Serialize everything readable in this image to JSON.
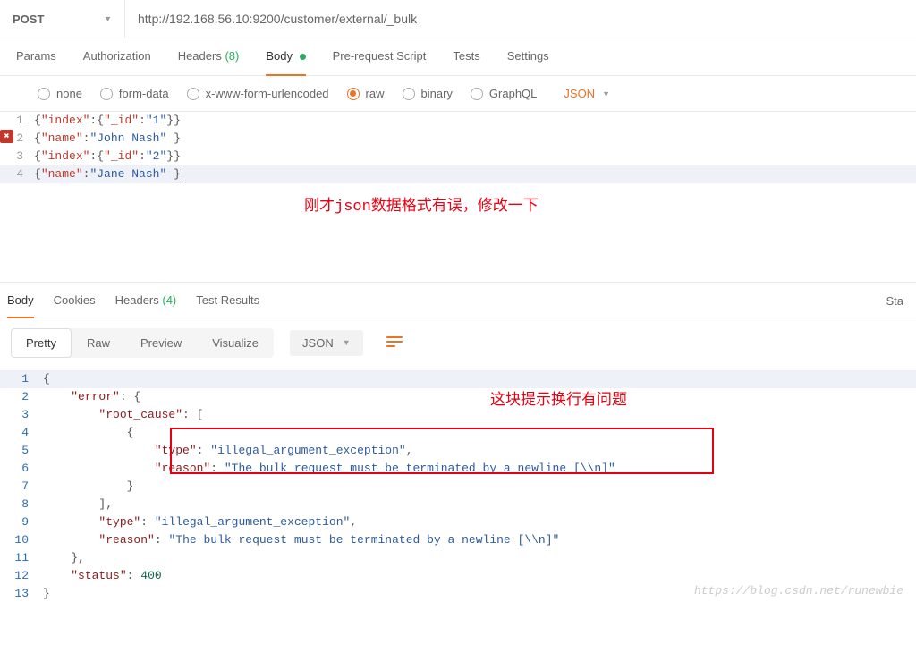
{
  "request": {
    "method": "POST",
    "url": "http://192.168.56.10:9200/customer/external/_bulk"
  },
  "tabs": {
    "params": "Params",
    "authorization": "Authorization",
    "headers": "Headers",
    "headers_count": "(8)",
    "body": "Body",
    "prerequest": "Pre-request Script",
    "tests": "Tests",
    "settings": "Settings"
  },
  "body_types": {
    "none": "none",
    "formdata": "form-data",
    "urlencoded": "x-www-form-urlencoded",
    "raw": "raw",
    "binary": "binary",
    "graphql": "GraphQL",
    "format": "JSON"
  },
  "request_body_lines": [
    "1",
    "2",
    "3",
    "4"
  ],
  "request_body": {
    "l1_index": "\"index\"",
    "l1_id_key": "\"_id\"",
    "l1_id_val": "\"1\"",
    "l2_name_key": "\"name\"",
    "l2_name_val": "\"John Nash\"",
    "l3_index": "\"index\"",
    "l3_id_key": "\"_id\"",
    "l3_id_val": "\"2\"",
    "l4_name_key": "\"name\"",
    "l4_name_val": "\"Jane Nash\"",
    "brace_open": "{",
    "brace_close": "}",
    "colon": ":",
    "space": " "
  },
  "annotations": {
    "note1": "刚才json数据格式有误，修改一下",
    "note2": "这块提示换行有问题"
  },
  "response_tabs": {
    "body": "Body",
    "cookies": "Cookies",
    "headers": "Headers",
    "headers_count": "(4)",
    "tests": "Test Results",
    "status_label": "Sta"
  },
  "view_modes": {
    "pretty": "Pretty",
    "raw": "Raw",
    "preview": "Preview",
    "visualize": "Visualize",
    "format": "JSON"
  },
  "response_lines": [
    "1",
    "2",
    "3",
    "4",
    "5",
    "6",
    "7",
    "8",
    "9",
    "10",
    "11",
    "12",
    "13"
  ],
  "response_json": {
    "error_key": "\"error\"",
    "root_cause_key": "\"root_cause\"",
    "type_key": "\"type\"",
    "type_val": "\"illegal_argument_exception\"",
    "reason_key": "\"reason\"",
    "reason_val": "\"The bulk request must be terminated by a newline [\\\\n]\"",
    "status_key": "\"status\"",
    "status_val": "400",
    "brace_open": "{",
    "brace_close": "}",
    "bracket_open": "[",
    "bracket_close": "]",
    "colon": ":",
    "comma": ",",
    "indent1": "    ",
    "indent2": "        ",
    "indent3": "            ",
    "indent4": "                "
  },
  "watermark": "https://blog.csdn.net/runewbie"
}
